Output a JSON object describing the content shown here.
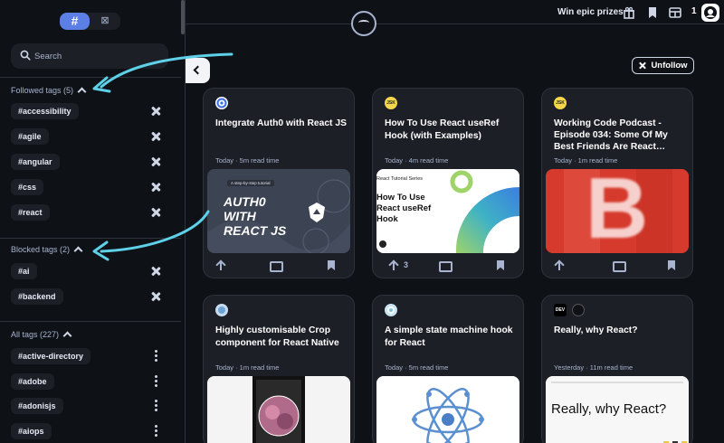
{
  "sidebar": {
    "search": {
      "placeholder": "Search"
    },
    "followed": {
      "heading": "Followed tags (5)",
      "tags": [
        "#accessibility",
        "#agile",
        "#angular",
        "#css",
        "#react"
      ]
    },
    "blocked": {
      "heading": "Blocked tags (2)",
      "tags": [
        "#ai",
        "#backend"
      ]
    },
    "all": {
      "heading": "All tags (227)",
      "tags": [
        "#active-directory",
        "#adobe",
        "#adonisjs",
        "#aiops"
      ]
    }
  },
  "header": {
    "prize_label": "Win epic prizes",
    "notification_count": "1"
  },
  "main": {
    "unfollow_label": "Unfollow",
    "cards": [
      {
        "source_badge": "",
        "title": "Integrate Auth0 with React JS",
        "meta": "Today · 5m read time",
        "image": {
          "small_label": "A step-by-step tutorial",
          "headline": "AUTH0 WITH REACT JS"
        },
        "upvotes": ""
      },
      {
        "source_badge": "JSK",
        "title": "How To Use React useRef Hook (with Examples)",
        "meta": "Today · 4m read time",
        "image": {
          "series": "React Tutorial Series",
          "headline": "How To Use React useRef Hook"
        },
        "upvotes": "3"
      },
      {
        "source_badge": "JSK",
        "title": "Working Code Podcast - Episode 034: Some Of My Best Friends Are React…",
        "meta": "Today · 1m read time",
        "image": {
          "letter": "B"
        },
        "upvotes": ""
      },
      {
        "source_badge": "",
        "title": "Highly customisable Crop component for React Native",
        "meta": "Today · 1m read time",
        "image": {},
        "upvotes": ""
      },
      {
        "source_badge": "",
        "title": "A simple state machine hook for React",
        "meta": "Today · 5m read time",
        "image": {},
        "upvotes": ""
      },
      {
        "source_badge": "DEV",
        "title": "Really, why React?",
        "meta": "Yesterday · 11m read time",
        "image": {
          "headline": "Really, why React?"
        },
        "upvotes": ""
      }
    ]
  }
}
